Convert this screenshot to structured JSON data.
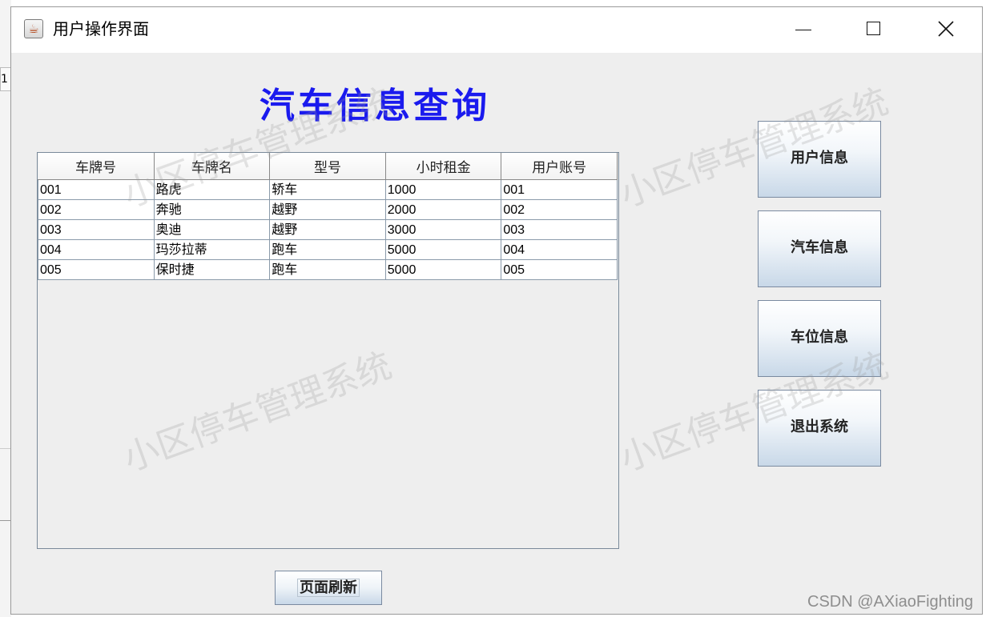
{
  "window": {
    "title": "用户操作界面",
    "icon": "java-cup-icon"
  },
  "heading": "汽车信息查询",
  "watermark": "小区停车管理系统",
  "table": {
    "columns": [
      "车牌号",
      "车牌名",
      "型号",
      "小时租金",
      "用户账号"
    ],
    "rows": [
      [
        "001",
        "路虎",
        "轿车",
        "1000",
        "001"
      ],
      [
        "002",
        "奔驰",
        "越野",
        "2000",
        "002"
      ],
      [
        "003",
        "奥迪",
        "越野",
        "3000",
        "003"
      ],
      [
        "004",
        "玛莎拉蒂",
        "跑车",
        "5000",
        "004"
      ],
      [
        "005",
        "保时捷",
        "跑车",
        "5000",
        "005"
      ]
    ]
  },
  "buttons": {
    "user_info": "用户信息",
    "car_info": "汽车信息",
    "space_info": "车位信息",
    "exit": "退出系统",
    "refresh": "页面刷新"
  },
  "background": {
    "fragment": "1"
  },
  "credit": "CSDN @AXiaoFighting",
  "colors": {
    "heading": "#1a1aee",
    "window_bg": "#eeeeee"
  }
}
